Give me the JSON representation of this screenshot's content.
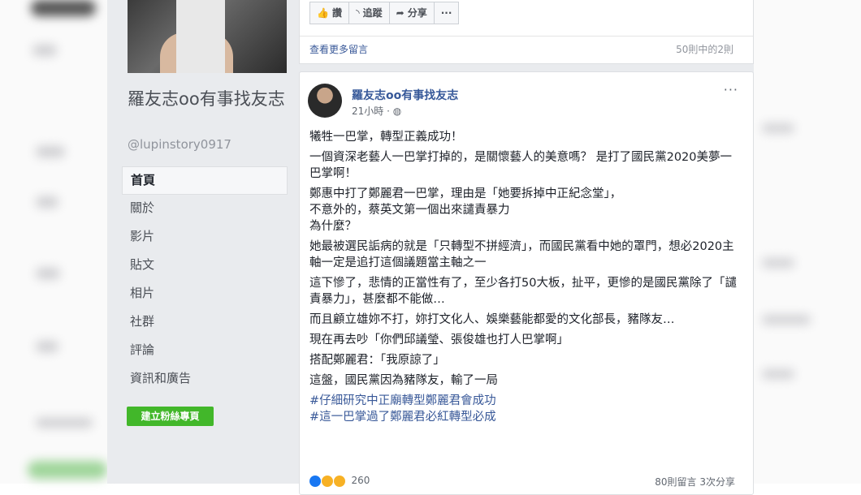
{
  "page": {
    "name": "羅友志oo有事找友志",
    "handle": "@lupinstory0917"
  },
  "nav": {
    "items": [
      "首頁",
      "關於",
      "影片",
      "貼文",
      "相片",
      "社群",
      "評論",
      "資訊和廣告"
    ],
    "create_label": "建立粉絲專頁"
  },
  "top_card": {
    "actions": [
      {
        "icon": "like-icon",
        "label": "讚"
      },
      {
        "icon": "follow-icon",
        "label": "追蹤"
      },
      {
        "icon": "share-icon",
        "label": "分享"
      },
      {
        "icon": "more-icon",
        "label": "···"
      }
    ],
    "more_comments": "查看更多留言",
    "comment_count": "50則中的2則"
  },
  "post": {
    "author": "羅友志oo有事找友志",
    "time": "21小時 · ",
    "privacy_icon": "globe-icon",
    "more": "···",
    "lines": [
      "犧牲一巴掌，轉型正義成功！",
      "一個資深老藝人一巴掌打掉的，是關懷藝人的美意嗎？ 是打了國民黨2020美夢一巴掌啊！",
      "鄭惠中打了鄭麗君一巴掌，理由是「她要拆掉中正紀念堂」，\n不意外的，蔡英文第一個出來譴責暴力\n為什麼？",
      "她最被選民詬病的就是「只轉型不拼經濟」，而國民黨看中她的罩門，想必2020主軸一定是追打這個議題當主軸之一",
      "這下慘了，悲情的正當性有了，至少各打50大板，扯平，更慘的是國民黨除了「譴責暴力」，甚麼都不能做…",
      "而且顧立雄妳不打，妳打文化人、娛樂藝能都愛的文化部長，豬隊友…",
      "現在再去吵「你們邱議瑩、張俊雄也打人巴掌啊」",
      "搭配鄭麗君：「我原諒了」",
      "這盤，國民黨因為豬隊友，輸了一局"
    ],
    "hashtags": [
      "#仔細研究中正廟轉型鄭麗君會成功",
      "#這一巴掌過了鄭麗君必紅轉型必成"
    ],
    "reactions_count": "260",
    "comments_shares": "80則留言 3次分享"
  },
  "colors": {
    "link": "#385898",
    "create_button": "#42b72a",
    "background": "#e9ebee"
  }
}
